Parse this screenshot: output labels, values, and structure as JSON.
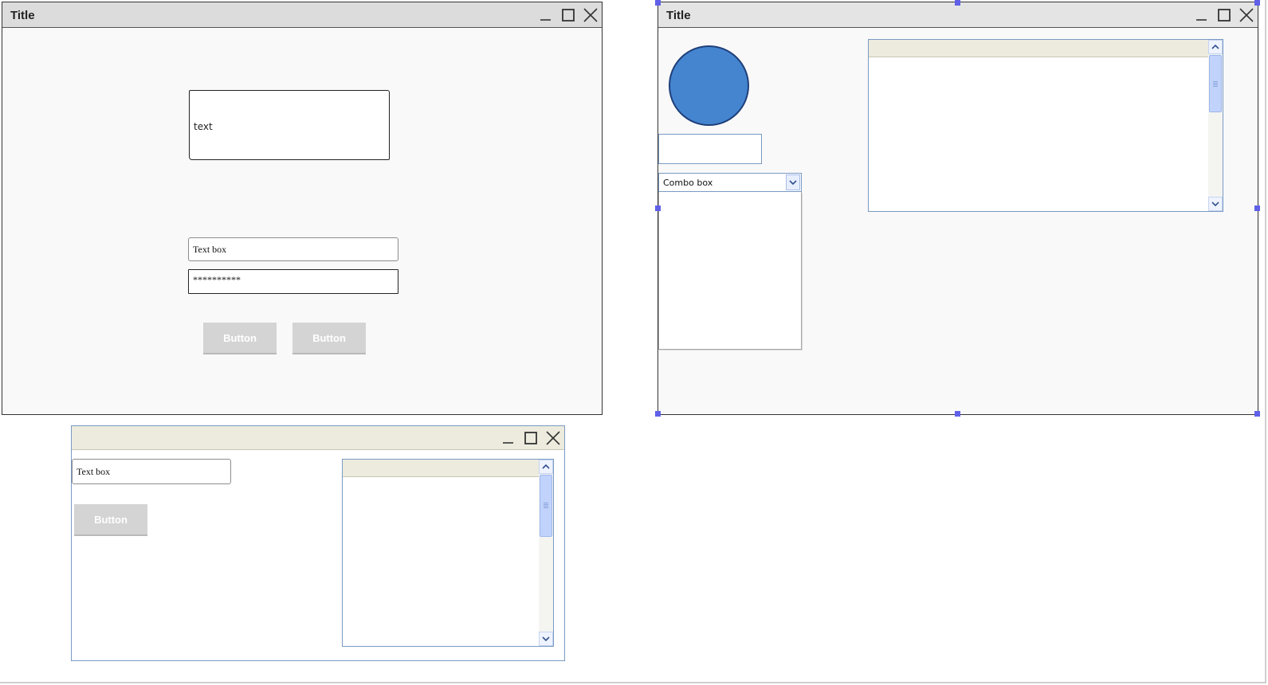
{
  "windows": {
    "left": {
      "title": "Title",
      "sketch_text": "text",
      "text_box": "Text box",
      "password": "**********",
      "button_1": "Button",
      "button_2": "Button"
    },
    "right": {
      "title": "Title",
      "combo_box": "Combo box"
    },
    "bottom": {
      "title": "",
      "text_box": "Text box",
      "button": "Button"
    }
  },
  "icons": {
    "minimize": "minimize-icon",
    "maximize": "maximize-icon",
    "close": "close-icon",
    "scroll_up": "chevron-up-icon",
    "scroll_down": "chevron-down-icon",
    "dropdown": "chevron-down-icon"
  },
  "colors": {
    "circle_fill": "#4585d0",
    "selection_handle": "#6060e8",
    "button_bg": "#d4d4d4"
  }
}
